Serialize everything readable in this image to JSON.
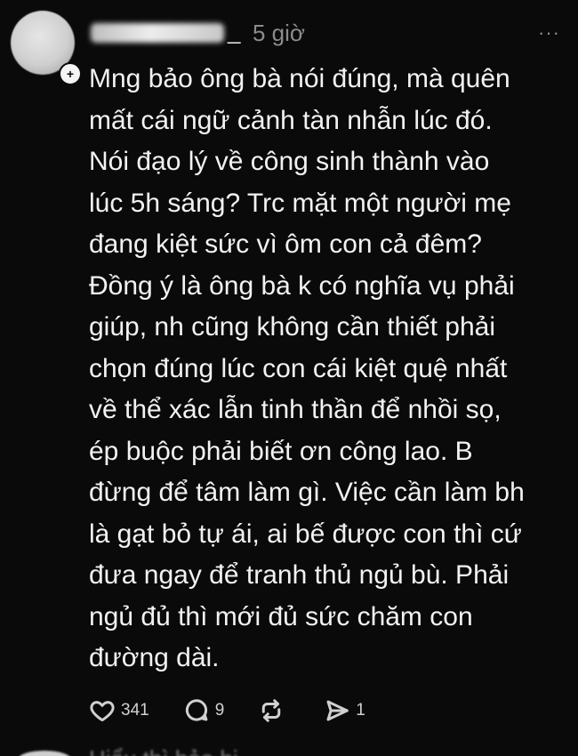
{
  "post": {
    "username_suffix": "_",
    "time": "5 giờ",
    "more_label": "···",
    "badge": "+",
    "text": "Mng bảo ông bà nói đúng, mà quên\nmất cái ngữ cảnh tàn nhẫn lúc đó.\nNói đạo lý về công sinh thành vào\nlúc 5h sáng? Trc mặt một người mẹ\nđang kiệt sức vì ôm con cả đêm?\nĐồng ý là ông bà k có nghĩa vụ phải\ngiúp, nh cũng không cần thiết phải\nchọn đúng lúc con cái kiệt quệ nhất\nvề thể xác lẫn tinh thần để nhồi sọ,\nép buộc phải biết ơn công lao. B\nđừng để tâm làm gì. Việc cần làm bh\nlà gạt bỏ tự ái, ai bế được con thì cứ\nđưa ngay để tranh thủ ngủ bù. Phải\nngủ đủ thì mới đủ sức chăm con\nđường dài.",
    "actions": {
      "likes": "341",
      "comments": "9",
      "reposts": "",
      "shares": "1"
    },
    "icons": {
      "like": "heart-icon",
      "comment": "comment-icon",
      "repost": "repost-icon",
      "share": "share-icon"
    }
  },
  "next_post": {
    "preview_text": "Hiểu thì bảo bị..."
  },
  "colors": {
    "background": "#0a0a0a",
    "text": "#f2f2f2",
    "muted": "#8c8c8c",
    "icon": "#d0d0d0"
  }
}
